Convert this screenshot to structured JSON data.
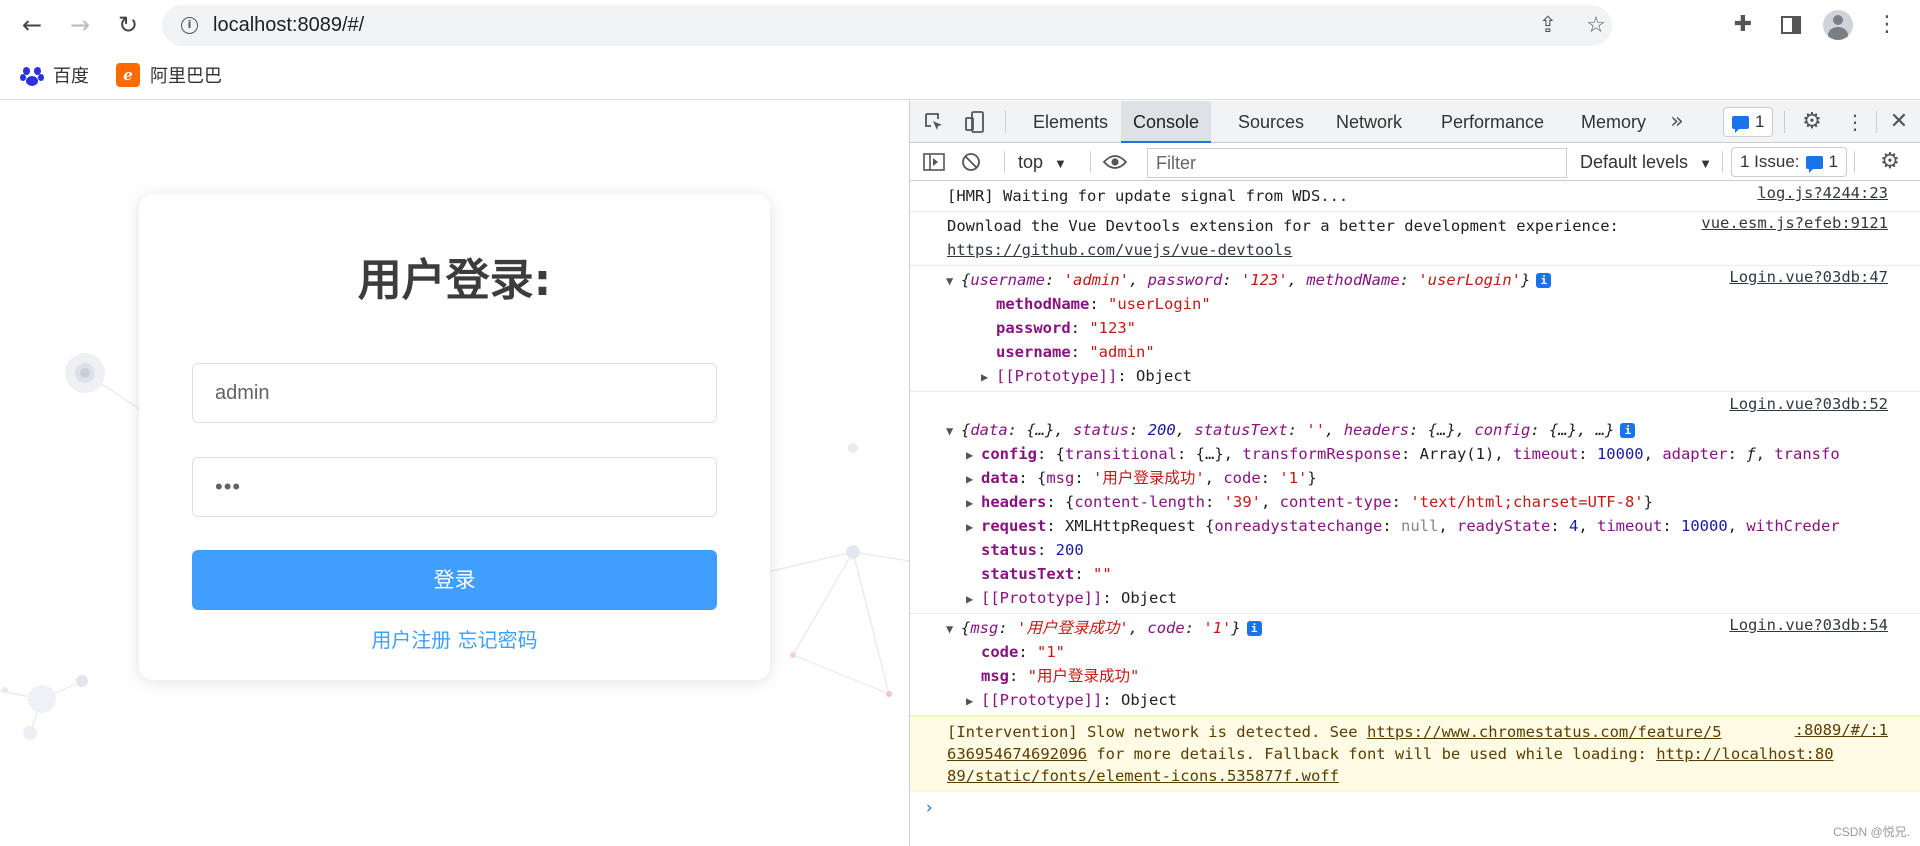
{
  "browser": {
    "url": "localhost:8089/#/",
    "bookmarks": [
      {
        "label": "百度",
        "icon": "baidu-paw-icon"
      },
      {
        "label": "阿里巴巴",
        "icon": "alibaba-icon"
      }
    ]
  },
  "login": {
    "title": "用户登录:",
    "username_value": "admin",
    "password_value": "123",
    "login_label": "登录",
    "register_link": "用户注册",
    "forgot_link": "忘记密码",
    "accent": "#409eff"
  },
  "devtools": {
    "tabs": [
      "Elements",
      "Console",
      "Sources",
      "Network",
      "Performance",
      "Memory"
    ],
    "active_tab": "Console",
    "more_tabs": "»",
    "messages_badge": "1",
    "context": "top",
    "filter_placeholder": "Filter",
    "levels": "Default levels",
    "issues_label": "1 Issue:",
    "issues_count": "1",
    "console": {
      "hmr": {
        "text": "[HMR] Waiting for update signal from WDS...",
        "src": "log.js?4244:23"
      },
      "vue": {
        "text": "Download the Vue Devtools extension for a better development experience:",
        "link": "https://github.com/vuejs/vue-devtools",
        "src": "vue.esm.js?efeb:9121"
      },
      "obj1": {
        "src": "Login.vue?03db:47",
        "k1": "username",
        "v1": "'admin'",
        "k2": "password",
        "v2": "'123'",
        "k3": "methodName",
        "v3": "'userLogin'",
        "r1k": "methodName",
        "r1v": "\"userLogin\"",
        "r2k": "password",
        "r2v": "\"123\"",
        "r3k": "username",
        "r3v": "\"admin\"",
        "proto": "[[Prototype]]",
        "proto_v": "Object"
      },
      "obj2": {
        "src": "Login.vue?03db:52",
        "h_data": "data",
        "h_data_v": "{…}",
        "h_status": "status",
        "h_status_v": "200",
        "h_stext": "statusText",
        "h_stext_v": "''",
        "h_headers": "headers",
        "h_headers_v": "{…}",
        "h_config": "config",
        "h_config_v": "{…}",
        "h_more": "…}",
        "config_k": "config",
        "config_trans_k": "transitional",
        "config_trans_v": "{…}",
        "config_tr_k": "transformResponse",
        "config_tr_v": "Array(1)",
        "config_to_k": "timeout",
        "config_to_v": "10000",
        "config_ad_k": "adapter",
        "config_ad_v": "ƒ",
        "config_tail": "transfo",
        "data_k": "data",
        "data_msg_k": "msg",
        "data_msg_v": "'用户登录成功'",
        "data_code_k": "code",
        "data_code_v": "'1'",
        "headers_k": "headers",
        "hd_cl_k": "content-length",
        "hd_cl_v": "'39'",
        "hd_ct_k": "content-type",
        "hd_ct_v": "'text/html;charset=UTF-8'",
        "request_k": "request",
        "request_type": "XMLHttpRequest",
        "rq_ors_k": "onreadystatechange",
        "rq_ors_v": "null",
        "rq_rs_k": "readyState",
        "rq_rs_v": "4",
        "rq_to_k": "timeout",
        "rq_to_v": "10000",
        "rq_tail": "withCreder",
        "status_k": "status",
        "status_v": "200",
        "stext_k": "statusText",
        "stext_v": "\"\"",
        "proto": "[[Prototype]]",
        "proto_v": "Object"
      },
      "obj3": {
        "src": "Login.vue?03db:54",
        "h_msg_k": "msg",
        "h_msg_v": "'用户登录成功'",
        "h_code_k": "code",
        "h_code_v": "'1'",
        "code_k": "code",
        "code_v": "\"1\"",
        "msg_k": "msg",
        "msg_v": "\"用户登录成功\"",
        "proto": "[[Prototype]]",
        "proto_v": "Object"
      },
      "warning": {
        "pre": "[Intervention] Slow network is detected. See ",
        "link1a": "https://www.chromestatus.com/feature/5",
        "src": ":8089/#/:1",
        "link1b": "636954674692096",
        "mid": " for more details. Fallback font will be used while loading: ",
        "link2a": "http://localhost:80",
        "link2b": "89/static/fonts/element-icons.535877f.woff"
      },
      "prompt": "›"
    }
  },
  "watermark": "CSDN @悦兄."
}
